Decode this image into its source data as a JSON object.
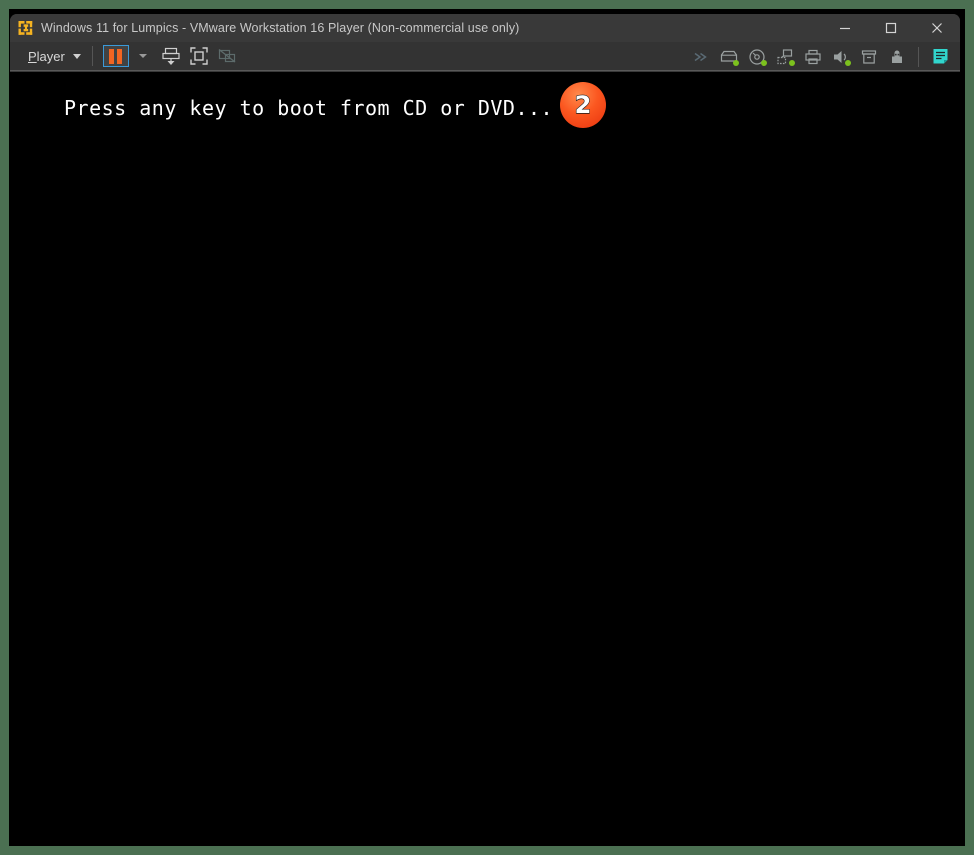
{
  "window": {
    "title": "Windows 11 for Lumpics - VMware Workstation 16 Player (Non-commercial use only)",
    "app_icon": "vmware-logo-icon",
    "controls": {
      "minimize": "—",
      "maximize": "☐",
      "close": "✕"
    }
  },
  "toolbar": {
    "player_menu": {
      "label_prefix": "",
      "accel": "P",
      "label_rest": "layer",
      "full_label": "Player"
    },
    "buttons": [
      {
        "name": "pause-vm-button",
        "icon": "pause-icon",
        "state": "active"
      },
      {
        "name": "pause-dropdown",
        "icon": "chevron-down-icon",
        "state": "enabled"
      },
      {
        "name": "send-ctrl-alt-del-button",
        "icon": "send-keys-icon",
        "state": "enabled"
      },
      {
        "name": "enter-fullscreen-button",
        "icon": "fullscreen-icon",
        "state": "enabled"
      },
      {
        "name": "unity-mode-button",
        "icon": "unity-mode-icon",
        "state": "disabled"
      }
    ],
    "status_icons": [
      {
        "name": "expand-status-icons",
        "icon": "double-chevron-right-icon",
        "connected": false
      },
      {
        "name": "hard-disk-status",
        "icon": "hard-disk-icon",
        "connected": true
      },
      {
        "name": "cd-dvd-status",
        "icon": "cd-dvd-icon",
        "connected": true
      },
      {
        "name": "network-adapter-status",
        "icon": "network-icon",
        "connected": true
      },
      {
        "name": "printer-status",
        "icon": "printer-icon",
        "connected": false
      },
      {
        "name": "sound-card-status",
        "icon": "speaker-icon",
        "connected": true
      },
      {
        "name": "removable-device-status",
        "icon": "removable-drive-icon",
        "connected": false
      },
      {
        "name": "usb-device-status",
        "icon": "usb-icon",
        "connected": false
      },
      {
        "name": "message-log-status",
        "icon": "message-log-icon",
        "connected": false
      }
    ]
  },
  "console": {
    "boot_prompt": "Press any key to boot from CD or DVD...",
    "background": "#000000",
    "text_color": "#ffffff"
  },
  "annotation": {
    "step_number": "2",
    "color": "#fb5720"
  },
  "colors": {
    "frame_green": "#4b7052",
    "titlebar": "#393939",
    "toolbar": "#333333",
    "accent_orange": "#f26522",
    "accent_cyan": "#31d6cd",
    "led_green": "#7cc11e",
    "vmware_gold": "#f5b321"
  }
}
